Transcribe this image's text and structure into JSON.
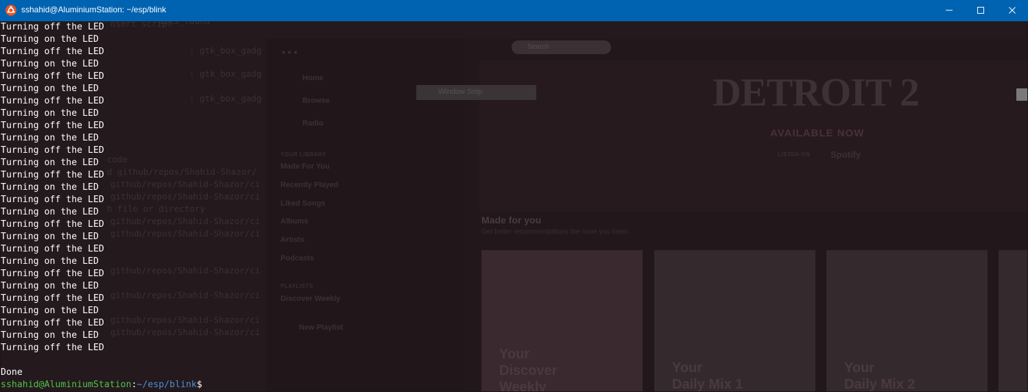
{
  "window": {
    "title": "sshahid@AluminiumStation: ~/esp/blink",
    "icon": "ubuntu-icon"
  },
  "terminal": {
    "output_lines": [
      "Turning off the LED",
      "Turning on the LED",
      "Turning off the LED",
      "Turning on the LED",
      "Turning off the LED",
      "Turning on the LED",
      "Turning off the LED",
      "Turning on the LED",
      "Turning off the LED",
      "Turning on the LED",
      "Turning off the LED",
      "Turning on the LED",
      "Turning off the LED",
      "Turning on the LED",
      "Turning off the LED",
      "Turning on the LED",
      "Turning off the LED",
      "Turning on the LED",
      "Turning off the LED",
      "Turning on the LED",
      "Turning off the LED",
      "Turning on the LED",
      "Turning off the LED",
      "Turning on the LED",
      "Turning off the LED",
      "Turning on the LED",
      "Turning off the LED"
    ],
    "blank_line": "",
    "done_text": "Done",
    "prompt": {
      "user_host": "sshahid@AluminiumStation",
      "separator": ":",
      "path": "~/esp/blink",
      "symbol": "$"
    },
    "colors": {
      "prompt_user": "#4ec24e",
      "prompt_path": "#4d8fd6",
      "titlebar": "#0063b1"
    }
  },
  "background_ghost": {
    "code": {
      "top_fragment": "ails_found",
      "line_1": "nsert script",
      "gtk_1": ": gtk_box_gadg",
      "gtk_2": ": gtk_box_gadg",
      "gtk_3": ": gtk_box_gadg",
      "code_label": "code",
      "repo_path": "d github/repos/Shahid-Shazor/",
      "path_frag_1": "github/repos/Shahid-Shazor/ci",
      "path_frag_2": "github/repos/Shahid-Shazor/ci",
      "no_such": "h file or directory",
      "path_frag_3": "github/repos/Shahid-Shazor/ci",
      "path_frag_4": "github/repos/Shahid-Shazor/ci",
      "path_frag_5": "github/repos/Shahid-Shazor/ci",
      "path_frag_6": "github/repos/Shahid-Shazor/ci",
      "path_frag_7": "github/repos/Shahid-Shazor/ci",
      "path_frag_8": "github/repos/Shahid-Shazor/ci"
    },
    "spotify": {
      "dots": "• • •",
      "search_placeholder": "Search",
      "nav": [
        "Home",
        "Browse",
        "Radio"
      ],
      "your_library": "YOUR LIBRARY",
      "library": [
        "Made For You",
        "Recently Played",
        "Liked Songs",
        "Albums",
        "Artists",
        "Podcasts"
      ],
      "playlists": "PLAYLISTS",
      "playlist_items": [
        "Discover Weekly"
      ],
      "new_playlist": "New Playlist",
      "window_snip": "Window Snip",
      "hero_title": "DETROIT 2",
      "hero_avail": "AVAILABLE NOW",
      "hero_listen": "LISTEN ON",
      "hero_brand": "Spotify",
      "made_for_you_title": "Made for you",
      "made_for_you_sub": "Get better recommendations the more you listen.",
      "cards": [
        {
          "line1": "Your",
          "line2": "Discover",
          "line3": "Weekly"
        },
        {
          "line1": "Your",
          "line2": "Daily Mix 1",
          "line3": ""
        },
        {
          "line1": "Your",
          "line2": "Daily Mix 2",
          "line3": ""
        }
      ]
    }
  }
}
